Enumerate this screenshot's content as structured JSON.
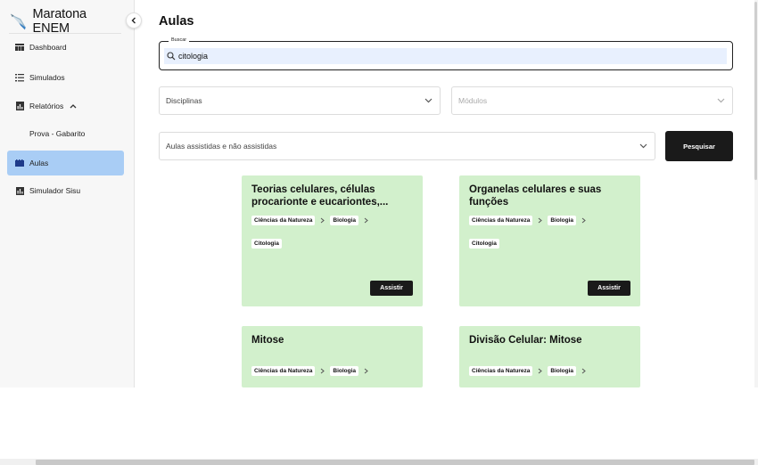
{
  "sidebar": {
    "brand": "Maratona ENEM",
    "items": [
      {
        "label": "Dashboard",
        "icon": "dashboard-icon"
      },
      {
        "label": "Simulados",
        "icon": "list-icon"
      },
      {
        "label": "Relatórios",
        "icon": "report-icon"
      },
      {
        "label": "Prova - Gabarito"
      },
      {
        "label": "Aulas",
        "icon": "video-icon"
      },
      {
        "label": "Simulador Sisu",
        "icon": "chart-icon"
      }
    ],
    "active_color": "#a9cdf5"
  },
  "main": {
    "title": "Aulas",
    "search": {
      "legend": "Buscar",
      "value": "citologia"
    },
    "filters": {
      "disciplinas": "Disciplinas",
      "modulos": "Módulos",
      "assistidas": "Aulas assistidas e não assistidas",
      "search_button": "Pesquisar"
    },
    "cards": [
      {
        "title": "Teorias celulares, células procarionte e eucariontes,...",
        "crumbs": [
          "Ciências da Natureza",
          "Biologia"
        ],
        "tag": "Citologia",
        "button": "Assistir"
      },
      {
        "title": "Organelas celulares e suas funções",
        "crumbs": [
          "Ciências da Natureza",
          "Biologia"
        ],
        "tag": "Citologia",
        "button": "Assistir"
      },
      {
        "title": "Mitose",
        "crumbs": [
          "Ciências da Natureza",
          "Biologia"
        ]
      },
      {
        "title": "Divisão Celular: Mitose",
        "crumbs": [
          "Ciências da Natureza",
          "Biologia"
        ]
      }
    ],
    "card_color": "#d2f0cc"
  }
}
